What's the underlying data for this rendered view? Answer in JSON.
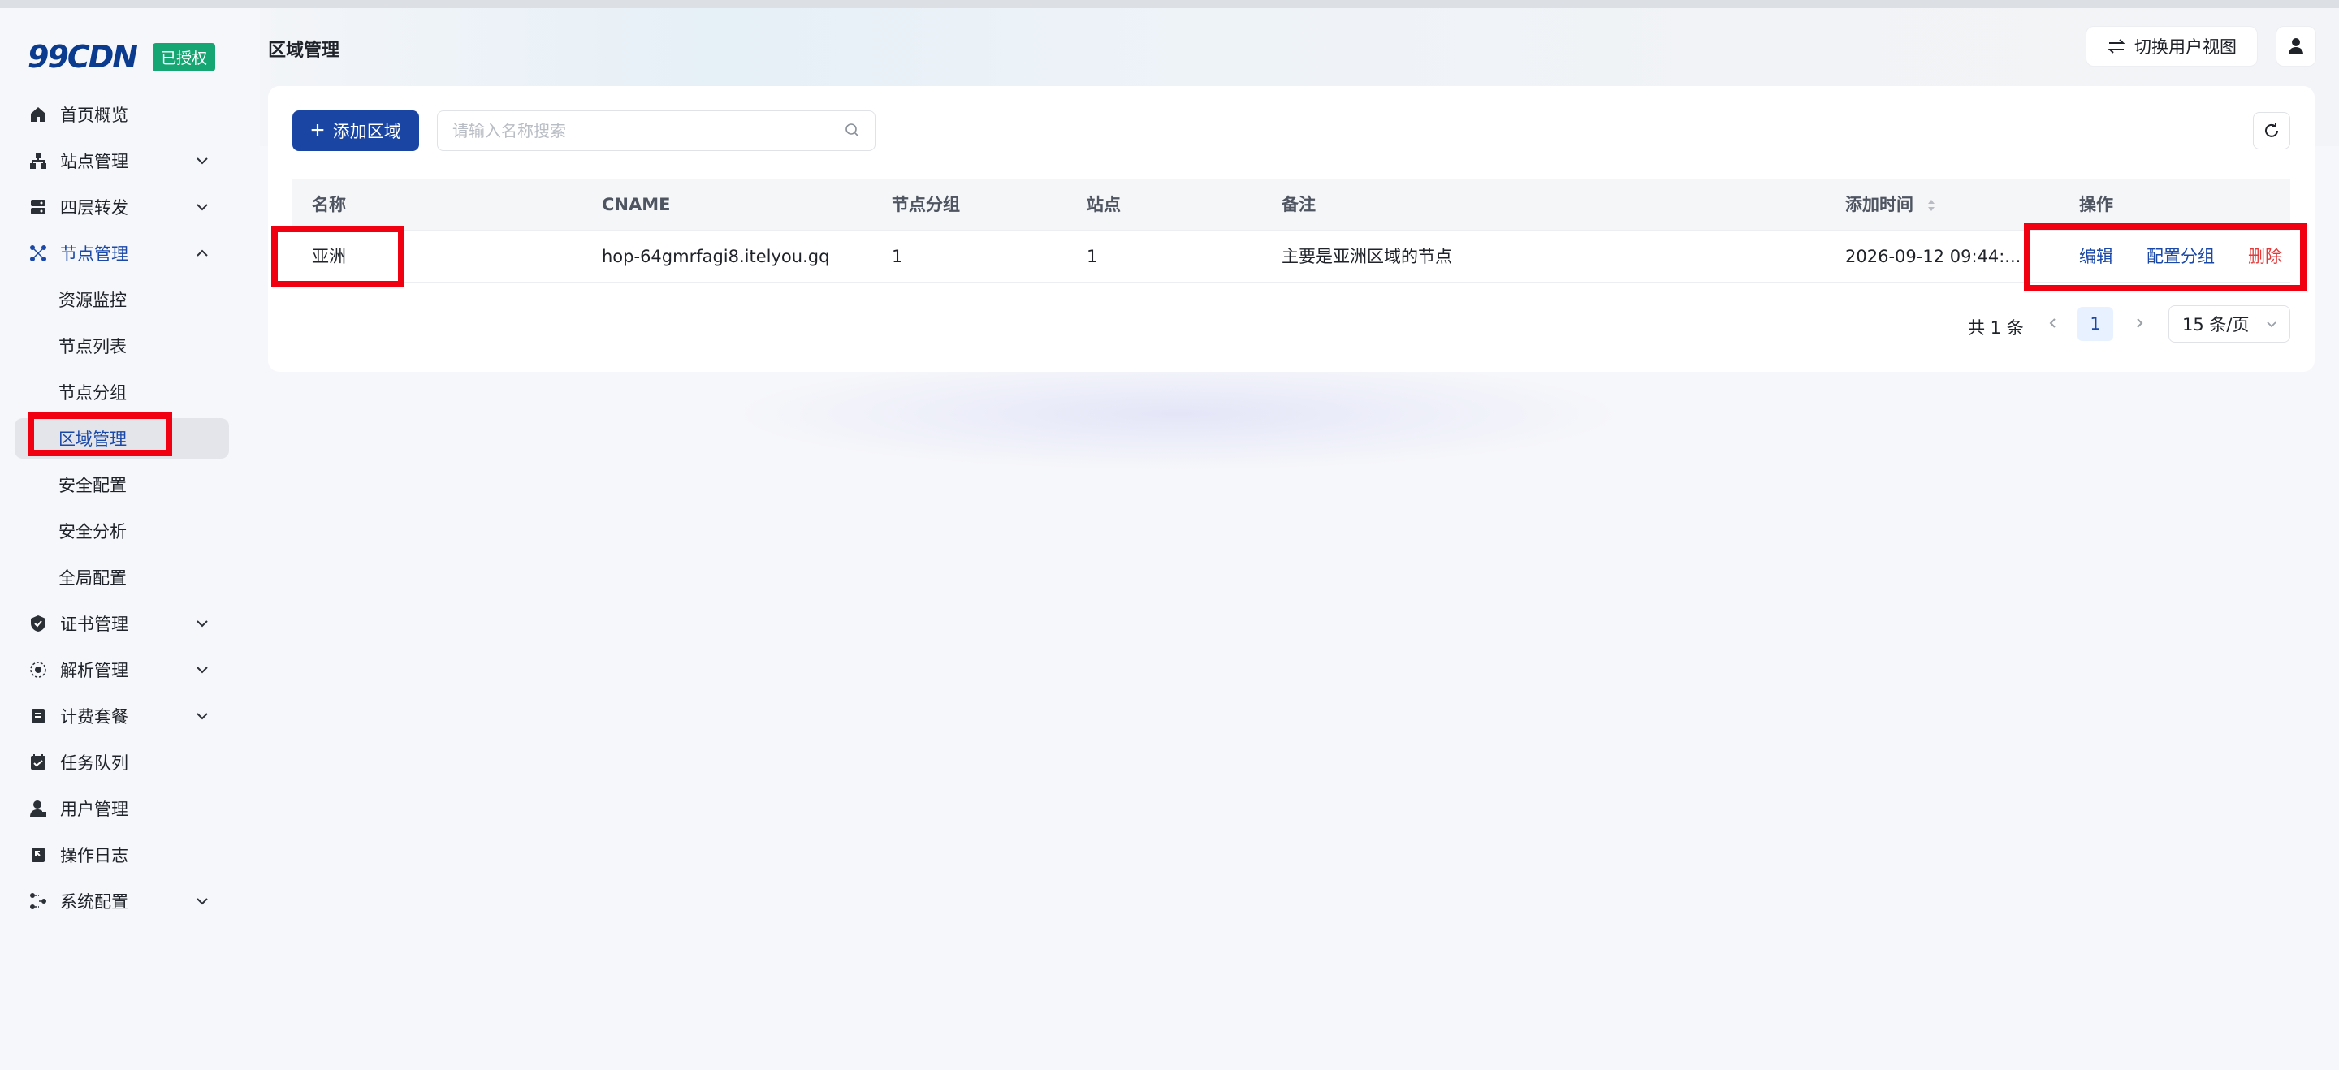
{
  "brand": {
    "logo": "99CDN",
    "badge": "已授权"
  },
  "sidebar": {
    "items": [
      {
        "label": "首页概览",
        "icon": "home-icon",
        "expandable": false
      },
      {
        "label": "站点管理",
        "icon": "sitemap-icon",
        "expandable": true
      },
      {
        "label": "四层转发",
        "icon": "server-icon",
        "expandable": true
      },
      {
        "label": "节点管理",
        "icon": "nodes-icon",
        "expandable": true,
        "expanded": true
      },
      {
        "label": "证书管理",
        "icon": "certificate-icon",
        "expandable": true
      },
      {
        "label": "解析管理",
        "icon": "dns-icon",
        "expandable": true
      },
      {
        "label": "计费套餐",
        "icon": "billing-icon",
        "expandable": true
      },
      {
        "label": "任务队列",
        "icon": "task-icon",
        "expandable": false
      },
      {
        "label": "用户管理",
        "icon": "user-icon",
        "expandable": false
      },
      {
        "label": "操作日志",
        "icon": "log-icon",
        "expandable": false
      },
      {
        "label": "系统配置",
        "icon": "settings-icon",
        "expandable": true
      }
    ],
    "node_submenu": [
      "资源监控",
      "节点列表",
      "节点分组",
      "区域管理",
      "安全配置",
      "安全分析",
      "全局配置"
    ],
    "selected_submenu": "区域管理"
  },
  "header": {
    "title": "区域管理",
    "switch_view": "切换用户视图"
  },
  "toolbar": {
    "add_label": "添加区域",
    "search_placeholder": "请输入名称搜索"
  },
  "table": {
    "columns": [
      "名称",
      "CNAME",
      "节点分组",
      "站点",
      "备注",
      "添加时间",
      "操作"
    ],
    "rows": [
      {
        "name": "亚洲",
        "cname": "hop-64gmrfagi8.itelyou.gq",
        "node_group": "1",
        "sites": "1",
        "remark": "主要是亚洲区域的节点",
        "added_at": "2026-09-12 09:44:...",
        "actions": {
          "edit": "编辑",
          "config_group": "配置分组",
          "delete": "删除"
        }
      }
    ]
  },
  "pagination": {
    "total": "共 1 条",
    "current_page": "1",
    "page_size": "15 条/页"
  },
  "colors": {
    "primary": "#1a45a3",
    "link": "#1a48a8",
    "danger": "#e03b3b",
    "badge": "#15a673",
    "highlight": "#f00010"
  }
}
